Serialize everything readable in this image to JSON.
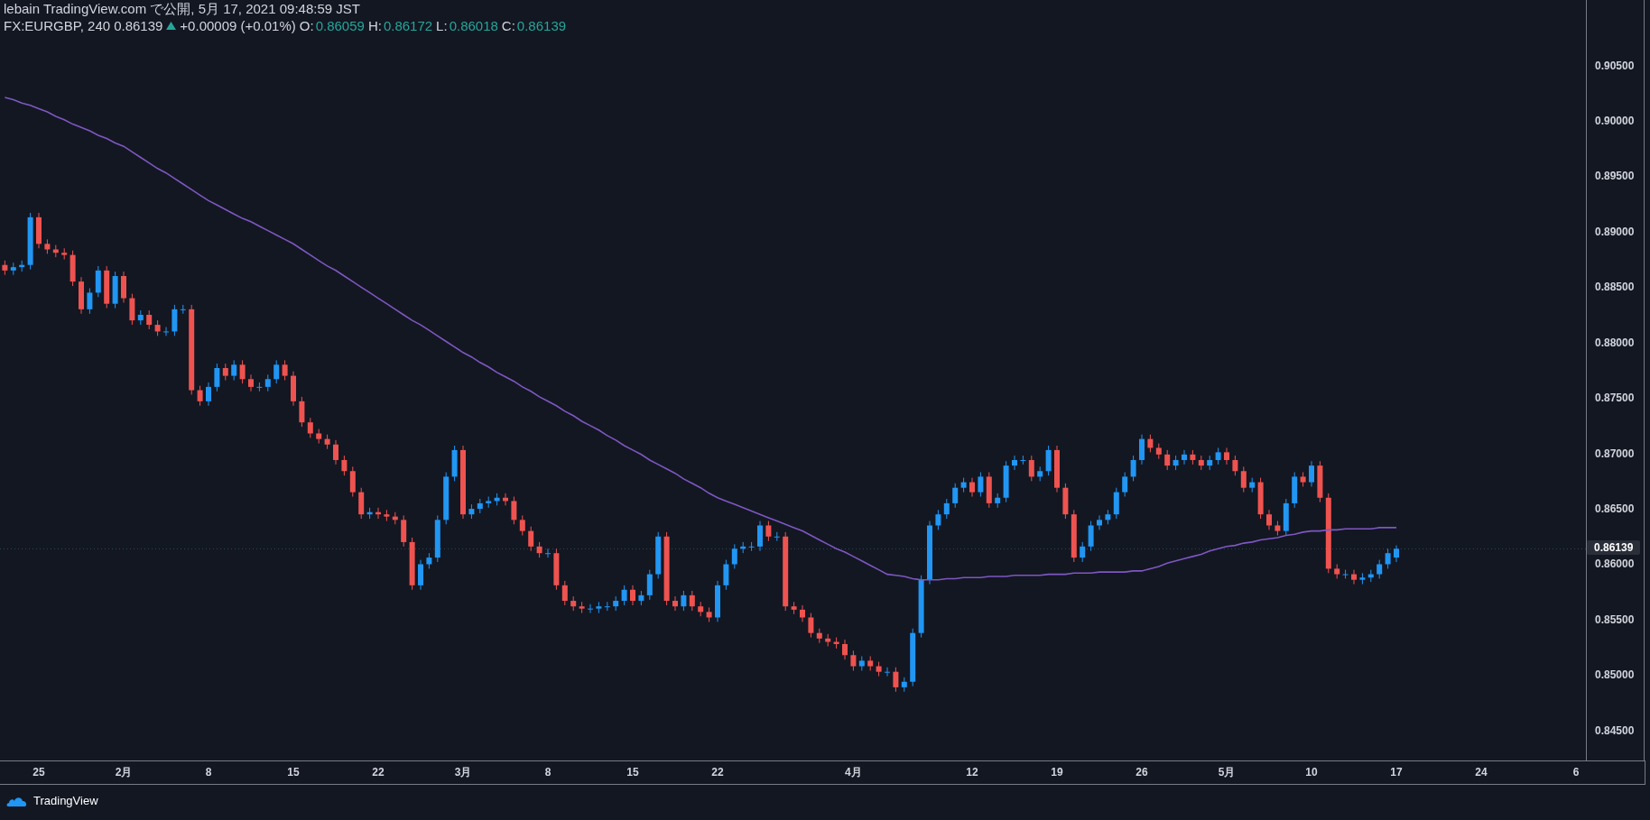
{
  "header": {
    "published": "lebain TradingView.com で公開, 5月 17, 2021 09:48:59 JST",
    "symbol": "FX:EURGBP, 240",
    "last": "0.86139",
    "up": true,
    "change": "+0.00009 (+0.01%)",
    "ohlc": [
      {
        "label": "O:",
        "value": "0.86059"
      },
      {
        "label": "H:",
        "value": "0.86172"
      },
      {
        "label": "L:",
        "value": "0.86018"
      },
      {
        "label": "C:",
        "value": "0.86139"
      }
    ]
  },
  "chart": {
    "last_price_label": "0.86139",
    "chart_data": {
      "type": "candlestick",
      "categories": [
        null,
        null,
        null,
        null,
        "25",
        null,
        null,
        null,
        null,
        null,
        null,
        null,
        null,
        null,
        "2月",
        null,
        null,
        null,
        null,
        null,
        null,
        null,
        null,
        null,
        "8",
        null,
        null,
        null,
        null,
        null,
        null,
        null,
        null,
        null,
        "15",
        null,
        null,
        null,
        null,
        null,
        null,
        null,
        null,
        null,
        "22",
        null,
        null,
        null,
        null,
        null,
        null,
        null,
        null,
        null,
        "3月",
        null,
        null,
        null,
        null,
        null,
        null,
        null,
        null,
        null,
        "8",
        null,
        null,
        null,
        null,
        null,
        null,
        null,
        null,
        null,
        "15",
        null,
        null,
        null,
        null,
        null,
        null,
        null,
        null,
        null,
        "22",
        null,
        null,
        null,
        null,
        null,
        null,
        null,
        null,
        null,
        null,
        null,
        null,
        null,
        null,
        null,
        "4月",
        null,
        null,
        null,
        null,
        null,
        null,
        null,
        null,
        null,
        null,
        null,
        null,
        null,
        "12",
        null,
        null,
        null,
        null,
        null,
        null,
        null,
        null,
        null,
        "19",
        null,
        null,
        null,
        null,
        null,
        null,
        null,
        null,
        null,
        "26",
        null,
        null,
        null,
        null,
        null,
        null,
        null,
        null,
        null,
        "5月",
        null,
        null,
        null,
        null,
        null,
        null,
        null,
        null,
        null,
        "10",
        null,
        null,
        null,
        null,
        null,
        null,
        null,
        null,
        null,
        "17",
        null,
        null,
        null,
        null,
        null,
        null,
        null,
        null,
        null,
        "24",
        null,
        null,
        null,
        null,
        null,
        null,
        null,
        null,
        null,
        null,
        null,
        "6"
      ],
      "ohlc": [
        [
          0.887,
          0.8874,
          0.8861,
          0.8865
        ],
        [
          0.8865,
          0.8872,
          0.8861,
          0.8868
        ],
        [
          0.8868,
          0.8874,
          0.8864,
          0.887
        ],
        [
          0.887,
          0.8917,
          0.8866,
          0.8913
        ],
        [
          0.8913,
          0.8917,
          0.8885,
          0.8889
        ],
        [
          0.8889,
          0.8893,
          0.888,
          0.8884
        ],
        [
          0.8884,
          0.8888,
          0.8877,
          0.8881
        ],
        [
          0.8881,
          0.8885,
          0.8875,
          0.8879
        ],
        [
          0.8879,
          0.8883,
          0.8851,
          0.8855
        ],
        [
          0.8855,
          0.8859,
          0.8826,
          0.883
        ],
        [
          0.883,
          0.8849,
          0.8826,
          0.8845
        ],
        [
          0.8845,
          0.8869,
          0.8841,
          0.8865
        ],
        [
          0.8865,
          0.8869,
          0.8831,
          0.8835
        ],
        [
          0.8835,
          0.8864,
          0.8831,
          0.886
        ],
        [
          0.886,
          0.8864,
          0.8836,
          0.884
        ],
        [
          0.884,
          0.8844,
          0.8816,
          0.882
        ],
        [
          0.882,
          0.8829,
          0.8816,
          0.8825
        ],
        [
          0.8825,
          0.8829,
          0.8812,
          0.8816
        ],
        [
          0.8816,
          0.882,
          0.8806,
          0.881
        ],
        [
          0.881,
          0.8814,
          0.8806,
          0.881
        ],
        [
          0.881,
          0.8834,
          0.8806,
          0.883
        ],
        [
          0.883,
          0.8834,
          0.8826,
          0.883
        ],
        [
          0.883,
          0.8834,
          0.8753,
          0.8757
        ],
        [
          0.8757,
          0.8761,
          0.8743,
          0.8747
        ],
        [
          0.8747,
          0.8764,
          0.8743,
          0.876
        ],
        [
          0.876,
          0.8781,
          0.8756,
          0.8777
        ],
        [
          0.8777,
          0.8781,
          0.8766,
          0.877
        ],
        [
          0.877,
          0.8784,
          0.8766,
          0.878
        ],
        [
          0.878,
          0.8784,
          0.8763,
          0.8767
        ],
        [
          0.8767,
          0.8771,
          0.8756,
          0.876
        ],
        [
          0.876,
          0.8764,
          0.8756,
          0.876
        ],
        [
          0.876,
          0.8771,
          0.8756,
          0.8767
        ],
        [
          0.8767,
          0.8784,
          0.8763,
          0.878
        ],
        [
          0.878,
          0.8784,
          0.8766,
          0.877
        ],
        [
          0.877,
          0.8774,
          0.8743,
          0.8747
        ],
        [
          0.8747,
          0.8751,
          0.8724,
          0.8728
        ],
        [
          0.8728,
          0.8732,
          0.8714,
          0.8718
        ],
        [
          0.8718,
          0.8722,
          0.8709,
          0.8713
        ],
        [
          0.8713,
          0.8717,
          0.8704,
          0.8708
        ],
        [
          0.8708,
          0.8712,
          0.869,
          0.8694
        ],
        [
          0.8694,
          0.8698,
          0.868,
          0.8684
        ],
        [
          0.8684,
          0.8688,
          0.8661,
          0.8665
        ],
        [
          0.8665,
          0.8669,
          0.8641,
          0.8645
        ],
        [
          0.8645,
          0.8651,
          0.8641,
          0.8647
        ],
        [
          0.8647,
          0.8651,
          0.8641,
          0.8645
        ],
        [
          0.8645,
          0.8649,
          0.8639,
          0.8643
        ],
        [
          0.8643,
          0.8647,
          0.8636,
          0.864
        ],
        [
          0.864,
          0.8644,
          0.8616,
          0.862
        ],
        [
          0.862,
          0.8624,
          0.8577,
          0.8581
        ],
        [
          0.8581,
          0.8604,
          0.8577,
          0.86
        ],
        [
          0.86,
          0.861,
          0.8596,
          0.8606
        ],
        [
          0.8606,
          0.8644,
          0.8602,
          0.864
        ],
        [
          0.864,
          0.8683,
          0.8636,
          0.8679
        ],
        [
          0.8679,
          0.8707,
          0.8675,
          0.8703
        ],
        [
          0.8703,
          0.8707,
          0.8641,
          0.8645
        ],
        [
          0.8645,
          0.8654,
          0.8641,
          0.865
        ],
        [
          0.865,
          0.8659,
          0.8646,
          0.8655
        ],
        [
          0.8655,
          0.8661,
          0.8651,
          0.8657
        ],
        [
          0.8657,
          0.8664,
          0.8653,
          0.866
        ],
        [
          0.866,
          0.8664,
          0.8653,
          0.8657
        ],
        [
          0.8657,
          0.8661,
          0.8636,
          0.864
        ],
        [
          0.864,
          0.8644,
          0.8626,
          0.863
        ],
        [
          0.863,
          0.8634,
          0.8612,
          0.8616
        ],
        [
          0.8616,
          0.862,
          0.8606,
          0.861
        ],
        [
          0.861,
          0.8614,
          0.8606,
          0.861
        ],
        [
          0.861,
          0.8614,
          0.8577,
          0.8581
        ],
        [
          0.8581,
          0.8585,
          0.8563,
          0.8567
        ],
        [
          0.8567,
          0.8571,
          0.8558,
          0.8562
        ],
        [
          0.8562,
          0.8566,
          0.8556,
          0.856
        ],
        [
          0.856,
          0.8564,
          0.8556,
          0.856
        ],
        [
          0.856,
          0.8566,
          0.8556,
          0.8562
        ],
        [
          0.8562,
          0.8566,
          0.8558,
          0.8562
        ],
        [
          0.8562,
          0.8571,
          0.8558,
          0.8567
        ],
        [
          0.8567,
          0.8581,
          0.8563,
          0.8577
        ],
        [
          0.8577,
          0.8581,
          0.8563,
          0.8567
        ],
        [
          0.8567,
          0.8576,
          0.8563,
          0.8572
        ],
        [
          0.8572,
          0.8595,
          0.8568,
          0.8591
        ],
        [
          0.8591,
          0.8629,
          0.8587,
          0.8625
        ],
        [
          0.8625,
          0.8629,
          0.8563,
          0.8567
        ],
        [
          0.8567,
          0.8571,
          0.8558,
          0.8562
        ],
        [
          0.8562,
          0.8576,
          0.8558,
          0.8572
        ],
        [
          0.8572,
          0.8576,
          0.8558,
          0.8562
        ],
        [
          0.8562,
          0.8566,
          0.8553,
          0.8557
        ],
        [
          0.8557,
          0.8561,
          0.8548,
          0.8552
        ],
        [
          0.8552,
          0.8585,
          0.8548,
          0.8581
        ],
        [
          0.8581,
          0.8604,
          0.8577,
          0.86
        ],
        [
          0.86,
          0.8618,
          0.8596,
          0.8614
        ],
        [
          0.8614,
          0.862,
          0.861,
          0.8616
        ],
        [
          0.8616,
          0.862,
          0.8612,
          0.8616
        ],
        [
          0.8616,
          0.8639,
          0.8612,
          0.8635
        ],
        [
          0.8635,
          0.8639,
          0.8621,
          0.8625
        ],
        [
          0.8625,
          0.8629,
          0.8621,
          0.8625
        ],
        [
          0.8625,
          0.8629,
          0.8558,
          0.8562
        ],
        [
          0.8562,
          0.8566,
          0.8555,
          0.8559
        ],
        [
          0.8559,
          0.8563,
          0.8548,
          0.8552
        ],
        [
          0.8552,
          0.8556,
          0.8534,
          0.8538
        ],
        [
          0.8538,
          0.8542,
          0.8529,
          0.8533
        ],
        [
          0.8533,
          0.8537,
          0.8526,
          0.853
        ],
        [
          0.853,
          0.8534,
          0.8524,
          0.8528
        ],
        [
          0.8528,
          0.8532,
          0.8514,
          0.8518
        ],
        [
          0.8518,
          0.8522,
          0.8504,
          0.8508
        ],
        [
          0.8508,
          0.8517,
          0.8504,
          0.8513
        ],
        [
          0.8513,
          0.8517,
          0.8504,
          0.8508
        ],
        [
          0.8508,
          0.8512,
          0.8499,
          0.8503
        ],
        [
          0.8503,
          0.8507,
          0.8499,
          0.8503
        ],
        [
          0.8503,
          0.8507,
          0.8485,
          0.8489
        ],
        [
          0.8489,
          0.8498,
          0.8485,
          0.8494
        ],
        [
          0.8494,
          0.8542,
          0.849,
          0.8538
        ],
        [
          0.8538,
          0.859,
          0.8534,
          0.8586
        ],
        [
          0.8586,
          0.8639,
          0.8582,
          0.8635
        ],
        [
          0.8635,
          0.8649,
          0.8631,
          0.8645
        ],
        [
          0.8645,
          0.8659,
          0.8641,
          0.8655
        ],
        [
          0.8655,
          0.8673,
          0.8651,
          0.8669
        ],
        [
          0.8669,
          0.8678,
          0.8665,
          0.8674
        ],
        [
          0.8674,
          0.8678,
          0.8661,
          0.8665
        ],
        [
          0.8665,
          0.8683,
          0.8661,
          0.8679
        ],
        [
          0.8679,
          0.8683,
          0.8651,
          0.8655
        ],
        [
          0.8655,
          0.8664,
          0.8651,
          0.866
        ],
        [
          0.866,
          0.8693,
          0.8656,
          0.8689
        ],
        [
          0.8689,
          0.8698,
          0.8685,
          0.8694
        ],
        [
          0.8694,
          0.8698,
          0.869,
          0.8694
        ],
        [
          0.8694,
          0.8698,
          0.8675,
          0.8679
        ],
        [
          0.8679,
          0.8688,
          0.8675,
          0.8684
        ],
        [
          0.8684,
          0.8707,
          0.868,
          0.8703
        ],
        [
          0.8703,
          0.8707,
          0.8665,
          0.8669
        ],
        [
          0.8669,
          0.8673,
          0.8641,
          0.8645
        ],
        [
          0.8645,
          0.8649,
          0.8602,
          0.8606
        ],
        [
          0.8606,
          0.862,
          0.8602,
          0.8616
        ],
        [
          0.8616,
          0.8639,
          0.8612,
          0.8635
        ],
        [
          0.8635,
          0.8644,
          0.8631,
          0.864
        ],
        [
          0.864,
          0.8649,
          0.8636,
          0.8645
        ],
        [
          0.8645,
          0.8669,
          0.8641,
          0.8665
        ],
        [
          0.8665,
          0.8683,
          0.8661,
          0.8679
        ],
        [
          0.8679,
          0.8698,
          0.8675,
          0.8694
        ],
        [
          0.8694,
          0.8717,
          0.869,
          0.8713
        ],
        [
          0.8713,
          0.8717,
          0.8701,
          0.8705
        ],
        [
          0.8705,
          0.8709,
          0.8695,
          0.8699
        ],
        [
          0.8699,
          0.8703,
          0.8685,
          0.8689
        ],
        [
          0.8689,
          0.8698,
          0.8685,
          0.8694
        ],
        [
          0.8694,
          0.8703,
          0.869,
          0.8699
        ],
        [
          0.8699,
          0.8703,
          0.869,
          0.8694
        ],
        [
          0.8694,
          0.8698,
          0.8685,
          0.8689
        ],
        [
          0.8689,
          0.8698,
          0.8685,
          0.8694
        ],
        [
          0.8694,
          0.8705,
          0.869,
          0.8701
        ],
        [
          0.8701,
          0.8705,
          0.869,
          0.8694
        ],
        [
          0.8694,
          0.8698,
          0.868,
          0.8684
        ],
        [
          0.8684,
          0.8688,
          0.8665,
          0.8669
        ],
        [
          0.8669,
          0.8678,
          0.8665,
          0.8674
        ],
        [
          0.8674,
          0.8678,
          0.8641,
          0.8645
        ],
        [
          0.8645,
          0.8649,
          0.8631,
          0.8635
        ],
        [
          0.8635,
          0.8639,
          0.8626,
          0.863
        ],
        [
          0.863,
          0.8659,
          0.8626,
          0.8655
        ],
        [
          0.8655,
          0.8683,
          0.8651,
          0.8679
        ],
        [
          0.8679,
          0.8683,
          0.867,
          0.8674
        ],
        [
          0.8674,
          0.8693,
          0.867,
          0.8689
        ],
        [
          0.8689,
          0.8693,
          0.8656,
          0.866
        ],
        [
          0.866,
          0.8664,
          0.8592,
          0.8596
        ],
        [
          0.8596,
          0.86,
          0.8587,
          0.8591
        ],
        [
          0.8591,
          0.8595,
          0.8587,
          0.8591
        ],
        [
          0.8591,
          0.8595,
          0.8582,
          0.8586
        ],
        [
          0.8586,
          0.8592,
          0.8582,
          0.8588
        ],
        [
          0.8588,
          0.8595,
          0.8584,
          0.8591
        ],
        [
          0.8591,
          0.8604,
          0.8587,
          0.86
        ],
        [
          0.86,
          0.8614,
          0.8596,
          0.861
        ],
        [
          0.8606,
          0.8617,
          0.8602,
          0.8614
        ],
        null,
        null,
        null,
        null,
        null,
        null,
        null,
        null,
        null,
        null,
        null,
        null,
        null,
        null,
        null,
        null,
        null,
        null,
        null,
        null,
        null,
        null
      ],
      "ref_lines": [
        {
          "axis": "y",
          "value": 0.86139,
          "color": "#2a4a5a"
        }
      ],
      "series": [
        {
          "type": "line",
          "color": "#7e57c2",
          "values": [
            0.9021,
            0.9019,
            0.9016,
            0.9014,
            0.9011,
            0.9008,
            0.9004,
            0.9001,
            0.8997,
            0.8994,
            0.8991,
            0.8987,
            0.8984,
            0.898,
            0.8977,
            0.8972,
            0.8967,
            0.8962,
            0.8957,
            0.8953,
            0.8948,
            0.8943,
            0.8938,
            0.8933,
            0.8928,
            0.8924,
            0.892,
            0.8916,
            0.8912,
            0.8909,
            0.8905,
            0.8901,
            0.8897,
            0.8893,
            0.8889,
            0.8884,
            0.8879,
            0.8874,
            0.8869,
            0.8865,
            0.886,
            0.8855,
            0.885,
            0.8845,
            0.884,
            0.8835,
            0.883,
            0.8825,
            0.882,
            0.8816,
            0.8811,
            0.8806,
            0.8801,
            0.8796,
            0.8791,
            0.8787,
            0.8782,
            0.8778,
            0.8773,
            0.8769,
            0.8765,
            0.876,
            0.8756,
            0.8751,
            0.8747,
            0.8743,
            0.8738,
            0.8734,
            0.8729,
            0.8725,
            0.8721,
            0.8716,
            0.8712,
            0.8707,
            0.8703,
            0.8699,
            0.8694,
            0.869,
            0.8686,
            0.8682,
            0.8677,
            0.8673,
            0.8669,
            0.8664,
            0.866,
            0.8657,
            0.8654,
            0.8651,
            0.8648,
            0.8645,
            0.8642,
            0.8639,
            0.8636,
            0.8633,
            0.863,
            0.8626,
            0.8622,
            0.8618,
            0.8614,
            0.8611,
            0.8607,
            0.8603,
            0.8599,
            0.8595,
            0.8591,
            0.859,
            0.8589,
            0.8587,
            0.8586,
            0.8586,
            0.8586,
            0.8587,
            0.8587,
            0.8588,
            0.8588,
            0.8588,
            0.8589,
            0.8589,
            0.8589,
            0.859,
            0.859,
            0.859,
            0.859,
            0.8591,
            0.8591,
            0.8591,
            0.8592,
            0.8592,
            0.8592,
            0.8593,
            0.8593,
            0.8593,
            0.8593,
            0.8594,
            0.8594,
            0.8596,
            0.8598,
            0.8601,
            0.8603,
            0.8605,
            0.8607,
            0.8609,
            0.8612,
            0.8614,
            0.8616,
            0.8617,
            0.8619,
            0.862,
            0.8622,
            0.8623,
            0.8624,
            0.8626,
            0.8627,
            0.8629,
            0.863,
            0.863,
            0.8631,
            0.8631,
            0.8632,
            0.8632,
            0.8632,
            0.8632,
            0.8633,
            0.8633,
            0.8633,
            null,
            null,
            null,
            null,
            null,
            null,
            null,
            null,
            null,
            null,
            null,
            null,
            null,
            null,
            null,
            null,
            null,
            null,
            null,
            null,
            null,
            null
          ]
        }
      ],
      "ylim": [
        0.8423,
        0.9109
      ],
      "yticks": [
        {
          "value": 0.905,
          "label": "0.90500"
        },
        {
          "value": 0.9,
          "label": "0.90000"
        },
        {
          "value": 0.895,
          "label": "0.89500"
        },
        {
          "value": 0.89,
          "label": "0.89000"
        },
        {
          "value": 0.885,
          "label": "0.88500"
        },
        {
          "value": 0.88,
          "label": "0.88000"
        },
        {
          "value": 0.875,
          "label": "0.87500"
        },
        {
          "value": 0.87,
          "label": "0.87000"
        },
        {
          "value": 0.865,
          "label": "0.86500"
        },
        {
          "value": 0.86,
          "label": "0.86000"
        },
        {
          "value": 0.855,
          "label": "0.85500"
        },
        {
          "value": 0.85,
          "label": "0.85000"
        },
        {
          "value": 0.845,
          "label": "0.84500"
        }
      ]
    }
  },
  "footer": {
    "brand": "TradingView"
  }
}
